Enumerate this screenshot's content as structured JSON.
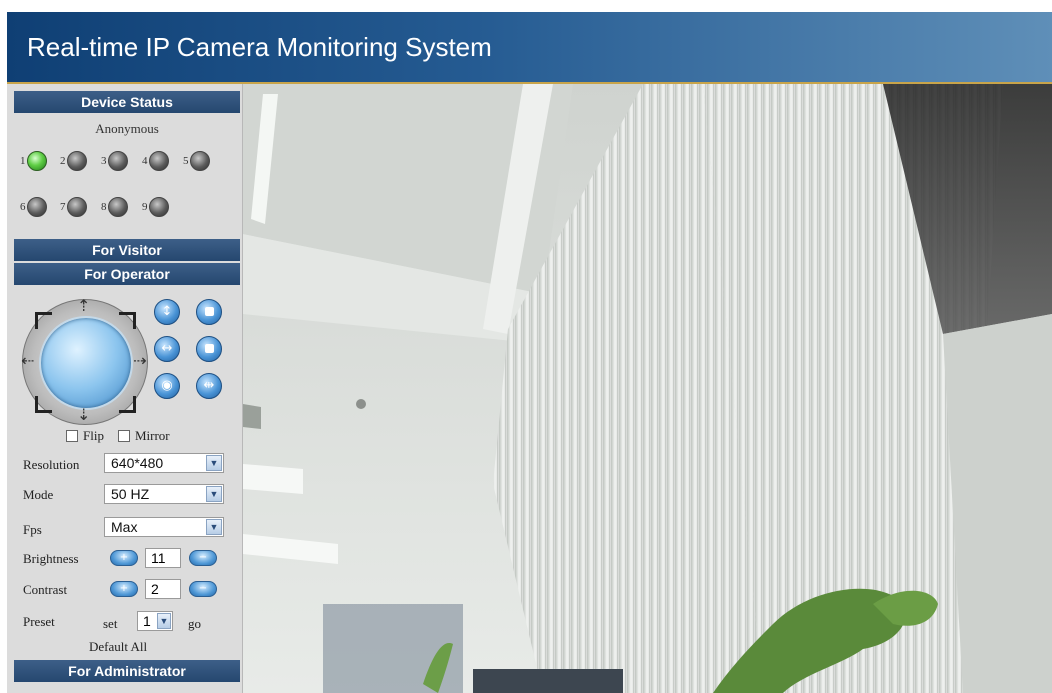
{
  "header": {
    "title": "Real-time IP Camera Monitoring System"
  },
  "device_status": {
    "heading": "Device Status",
    "user": "Anonymous",
    "devices": [
      {
        "num": "1",
        "online": true
      },
      {
        "num": "2",
        "online": false
      },
      {
        "num": "3",
        "online": false
      },
      {
        "num": "4",
        "online": false
      },
      {
        "num": "5",
        "online": false
      },
      {
        "num": "6",
        "online": false
      },
      {
        "num": "7",
        "online": false
      },
      {
        "num": "8",
        "online": false
      },
      {
        "num": "9",
        "online": false
      }
    ]
  },
  "sections": {
    "visitor": "For Visitor",
    "operator": "For Operator",
    "administrator": "For Administrator"
  },
  "controls": {
    "flip_label": "Flip",
    "mirror_label": "Mirror",
    "resolution_label": "Resolution",
    "resolution_value": "640*480",
    "mode_label": "Mode",
    "mode_value": "50 HZ",
    "fps_label": "Fps",
    "fps_value": "Max",
    "brightness_label": "Brightness",
    "brightness_value": "11",
    "contrast_label": "Contrast",
    "contrast_value": "2",
    "preset_label": "Preset",
    "preset_set": "set",
    "preset_value": "1",
    "preset_go": "go",
    "default_all": "Default All"
  },
  "colors": {
    "header_start": "#0f3f74",
    "header_end": "#5f8fb8",
    "section_bar": "#25476f",
    "sidebar_bg": "#dcdcdc",
    "led_online": "#5fce45"
  }
}
